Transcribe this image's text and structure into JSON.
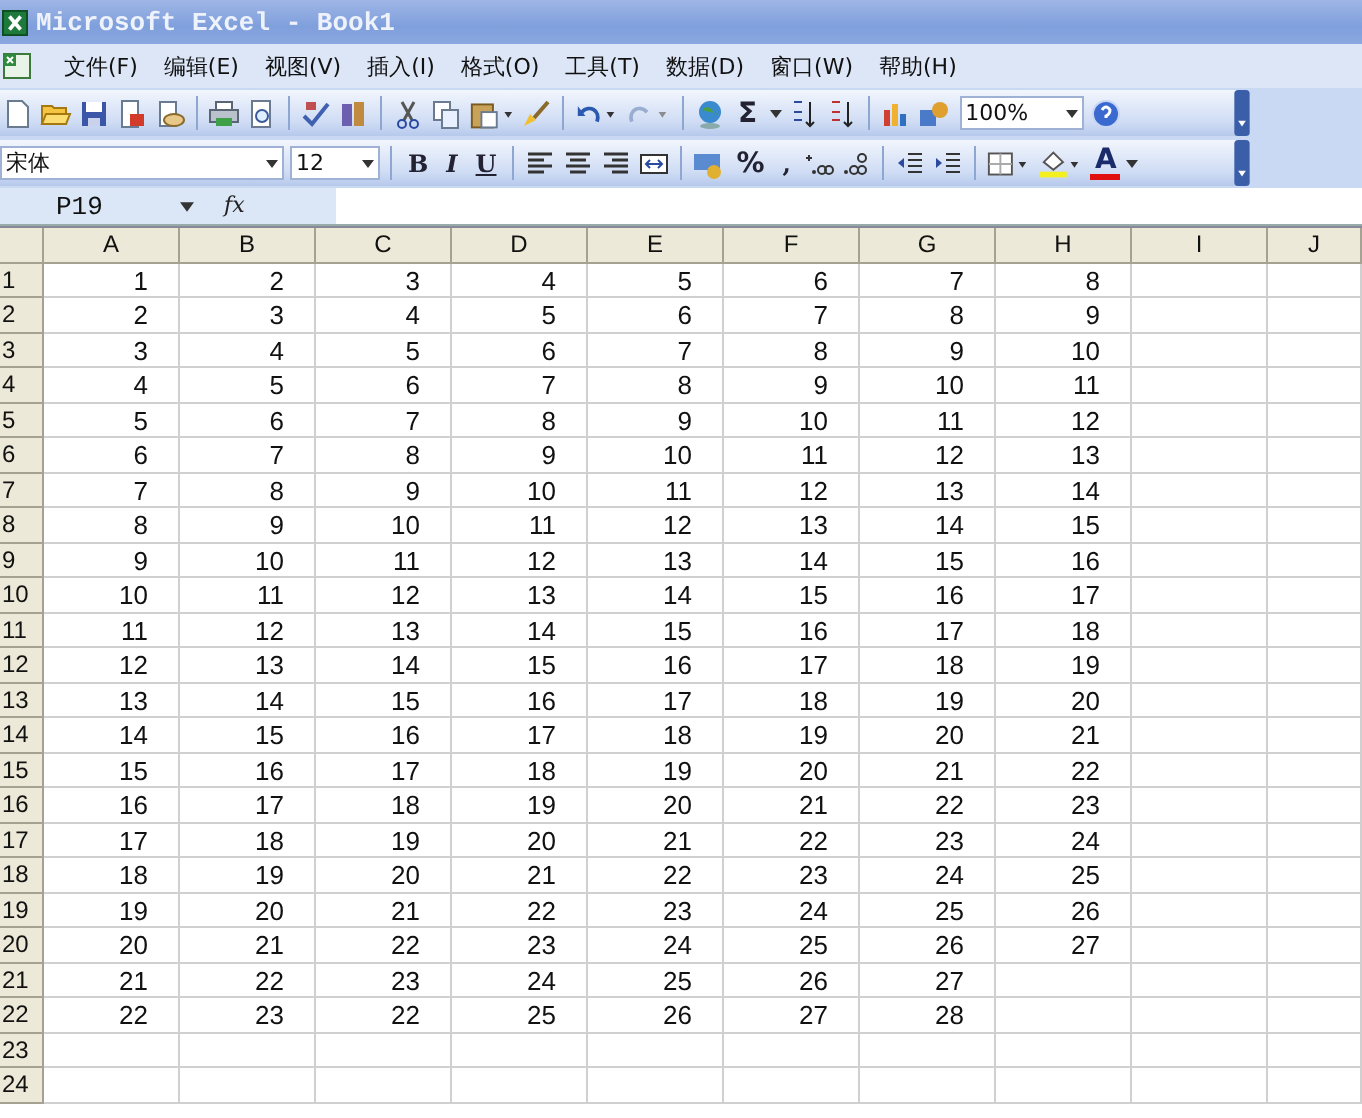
{
  "window": {
    "title": "Microsoft Excel - Book1"
  },
  "menu": [
    "文件(F)",
    "编辑(E)",
    "视图(V)",
    "插入(I)",
    "格式(O)",
    "工具(T)",
    "数据(D)",
    "窗口(W)",
    "帮助(H)"
  ],
  "standard_toolbar": {
    "sum_glyph": "Σ",
    "zoom": "100%"
  },
  "formatting_toolbar": {
    "font": "宋体",
    "size": "12",
    "bold": "B",
    "italic": "I",
    "underline": "U",
    "percent": "%",
    "comma": ",",
    "font_color_glyph": "A"
  },
  "formula_bar": {
    "name_box": "P19",
    "fx": "fx"
  },
  "sheet": {
    "columns": [
      "A",
      "B",
      "C",
      "D",
      "E",
      "F",
      "G",
      "H",
      "I",
      "J"
    ],
    "rows": [
      {
        "header": "1",
        "cells": [
          "1",
          "2",
          "3",
          "4",
          "5",
          "6",
          "7",
          "8"
        ]
      },
      {
        "header": "2",
        "cells": [
          "2",
          "3",
          "4",
          "5",
          "6",
          "7",
          "8",
          "9"
        ]
      },
      {
        "header": "3",
        "cells": [
          "3",
          "4",
          "5",
          "6",
          "7",
          "8",
          "9",
          "10"
        ]
      },
      {
        "header": "4",
        "cells": [
          "4",
          "5",
          "6",
          "7",
          "8",
          "9",
          "10",
          "11"
        ]
      },
      {
        "header": "5",
        "cells": [
          "5",
          "6",
          "7",
          "8",
          "9",
          "10",
          "11",
          "12"
        ]
      },
      {
        "header": "6",
        "cells": [
          "6",
          "7",
          "8",
          "9",
          "10",
          "11",
          "12",
          "13"
        ]
      },
      {
        "header": "7",
        "cells": [
          "7",
          "8",
          "9",
          "10",
          "11",
          "12",
          "13",
          "14"
        ]
      },
      {
        "header": "8",
        "cells": [
          "8",
          "9",
          "10",
          "11",
          "12",
          "13",
          "14",
          "15"
        ]
      },
      {
        "header": "9",
        "cells": [
          "9",
          "10",
          "11",
          "12",
          "13",
          "14",
          "15",
          "16"
        ]
      },
      {
        "header": "10",
        "cells": [
          "10",
          "11",
          "12",
          "13",
          "14",
          "15",
          "16",
          "17"
        ]
      },
      {
        "header": "11",
        "cells": [
          "11",
          "12",
          "13",
          "14",
          "15",
          "16",
          "17",
          "18"
        ]
      },
      {
        "header": "12",
        "cells": [
          "12",
          "13",
          "14",
          "15",
          "16",
          "17",
          "18",
          "19"
        ]
      },
      {
        "header": "13",
        "cells": [
          "13",
          "14",
          "15",
          "16",
          "17",
          "18",
          "19",
          "20"
        ]
      },
      {
        "header": "14",
        "cells": [
          "14",
          "15",
          "16",
          "17",
          "18",
          "19",
          "20",
          "21"
        ]
      },
      {
        "header": "15",
        "cells": [
          "15",
          "16",
          "17",
          "18",
          "19",
          "20",
          "21",
          "22"
        ]
      },
      {
        "header": "16",
        "cells": [
          "16",
          "17",
          "18",
          "19",
          "20",
          "21",
          "22",
          "23"
        ]
      },
      {
        "header": "17",
        "cells": [
          "17",
          "18",
          "19",
          "20",
          "21",
          "22",
          "23",
          "24"
        ]
      },
      {
        "header": "18",
        "cells": [
          "18",
          "19",
          "20",
          "21",
          "22",
          "23",
          "24",
          "25"
        ]
      },
      {
        "header": "19",
        "cells": [
          "19",
          "20",
          "21",
          "22",
          "23",
          "24",
          "25",
          "26"
        ]
      },
      {
        "header": "20",
        "cells": [
          "20",
          "21",
          "22",
          "23",
          "24",
          "25",
          "26",
          "27"
        ]
      },
      {
        "header": "21",
        "cells": [
          "21",
          "22",
          "23",
          "24",
          "25",
          "26",
          "27"
        ]
      },
      {
        "header": "22",
        "cells": [
          "22",
          "23",
          "22",
          "25",
          "26",
          "27",
          "28"
        ]
      },
      {
        "header": "23"
      },
      {
        "header": "24"
      }
    ]
  }
}
